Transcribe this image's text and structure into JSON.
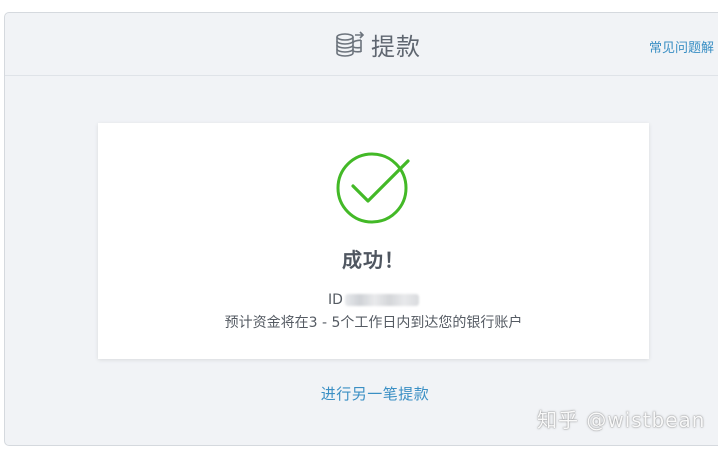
{
  "header": {
    "title": "提款",
    "title_icon": "coins-withdraw-icon",
    "faq_link": "常见问题解"
  },
  "result": {
    "status_icon": "check-circle-icon",
    "status_color": "#43b927",
    "title": "成功！",
    "id_label": "ID",
    "eta_message": "预计资金将在3 - 5个工作日内到达您的银行账户"
  },
  "actions": {
    "another_withdrawal": "进行另一笔提款"
  },
  "watermark": {
    "text": "知乎 @wistbean"
  },
  "colors": {
    "link": "#3a8fc4",
    "panel_bg": "#f1f3f6",
    "text": "#555b63"
  }
}
